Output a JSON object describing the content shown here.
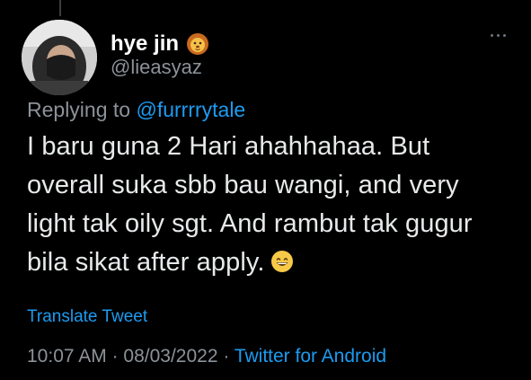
{
  "tweet": {
    "author": {
      "display_name": "hye jin",
      "handle": "@lieasyaz",
      "name_badge_icon": "lion-face-emoji"
    },
    "reply_prefix": "Replying to ",
    "reply_to": "@furrrrytale",
    "text_lines": [
      "I baru guna 2 Hari ahahhahaa. But",
      "overall suka sbb bau wangi, and very",
      "light tak oily sgt. And rambut tak gugur",
      "bila sikat after apply."
    ],
    "trailing_emoji": "grinning-face-emoji",
    "translate_label": "Translate Tweet",
    "time": "10:07 AM",
    "separator": " · ",
    "date": "08/03/2022",
    "source": "Twitter for Android"
  },
  "colors": {
    "background": "#000000",
    "text": "#e7e9ea",
    "secondary": "#8b9298",
    "link": "#1d9bf0"
  }
}
